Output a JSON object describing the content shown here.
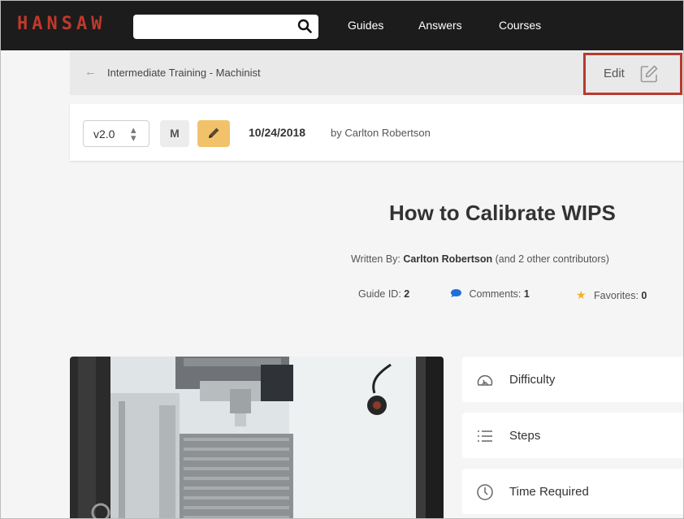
{
  "nav": {
    "logo": "HANSAW",
    "search_placeholder": "",
    "links": [
      "Guides",
      "Answers",
      "Courses"
    ]
  },
  "breadcrumb": {
    "text": "Intermediate Training - Machinist",
    "edit_label": "Edit"
  },
  "version_bar": {
    "version": "v2.0",
    "badge": "M",
    "date": "10/24/2018",
    "author": "by Carlton Robertson"
  },
  "guide": {
    "title": "How to Calibrate WIPS",
    "written_by_prefix": "Written By:",
    "written_by_name": "Carlton Robertson",
    "written_by_suffix": "(and 2 other contributors)",
    "guide_id_label": "Guide ID:",
    "guide_id": "2",
    "comments_label": "Comments:",
    "comments": "1",
    "favorites_label": "Favorites:",
    "favorites": "0"
  },
  "sidebar": {
    "items": [
      {
        "label": "Difficulty",
        "icon": "gauge-icon"
      },
      {
        "label": "Steps",
        "icon": "list-icon"
      },
      {
        "label": "Time Required",
        "icon": "clock-icon"
      }
    ]
  },
  "colors": {
    "brand": "#c0392b",
    "highlight": "#b83a2e",
    "pencil_button": "#f2c26b",
    "comment_icon": "#1e6fd9",
    "star_icon": "#f0b323"
  }
}
